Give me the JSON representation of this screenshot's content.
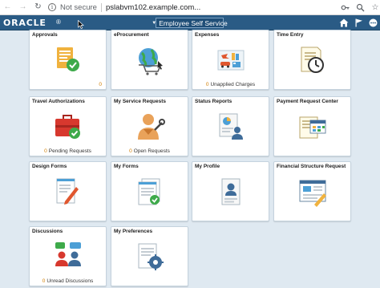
{
  "browser": {
    "back_icon": "arrow-left-icon",
    "forward_icon": "arrow-right-icon",
    "reload_icon": "reload-icon",
    "security_label": "Not secure",
    "url": "pslabvm102.example.com...",
    "toolbar_icons": [
      "key-icon",
      "zoom-icon",
      "star-icon"
    ]
  },
  "header": {
    "logo_text": "ORACLE",
    "homepage_label": "Employee Self Service",
    "icons": [
      "home-icon",
      "flag-icon",
      "actions-list-icon"
    ]
  },
  "colors": {
    "header_bg": "#2a5b85",
    "page_bg": "#dfe9f1",
    "count_accent": "#d17d00"
  },
  "tiles": [
    {
      "title": "Approvals",
      "icon": "approvals-icon",
      "count": "0",
      "count_label": ""
    },
    {
      "title": "eProcurement",
      "icon": "eprocurement-icon",
      "count": "",
      "count_label": ""
    },
    {
      "title": "Expenses",
      "icon": "expenses-icon",
      "count": "0",
      "count_label": "Unapplied Charges"
    },
    {
      "title": "Time Entry",
      "icon": "time-entry-icon",
      "count": "",
      "count_label": ""
    },
    {
      "title": "Travel Authorizations",
      "icon": "travel-authorizations-icon",
      "count": "0",
      "count_label": "Pending Requests"
    },
    {
      "title": "My Service Requests",
      "icon": "service-requests-icon",
      "count": "0",
      "count_label": "Open Requests"
    },
    {
      "title": "Status Reports",
      "icon": "status-reports-icon",
      "count": "",
      "count_label": ""
    },
    {
      "title": "Payment Request Center",
      "icon": "payment-request-icon",
      "count": "",
      "count_label": ""
    },
    {
      "title": "Design Forms",
      "icon": "design-forms-icon",
      "count": "",
      "count_label": ""
    },
    {
      "title": "My Forms",
      "icon": "my-forms-icon",
      "count": "",
      "count_label": ""
    },
    {
      "title": "My Profile",
      "icon": "my-profile-icon",
      "count": "",
      "count_label": ""
    },
    {
      "title": "Financial Structure Request",
      "icon": "financial-structure-icon",
      "count": "",
      "count_label": ""
    },
    {
      "title": "Discussions",
      "icon": "discussions-icon",
      "count": "0",
      "count_label": "Unread Discussions"
    },
    {
      "title": "My Preferences",
      "icon": "my-preferences-icon",
      "count": "",
      "count_label": ""
    }
  ]
}
